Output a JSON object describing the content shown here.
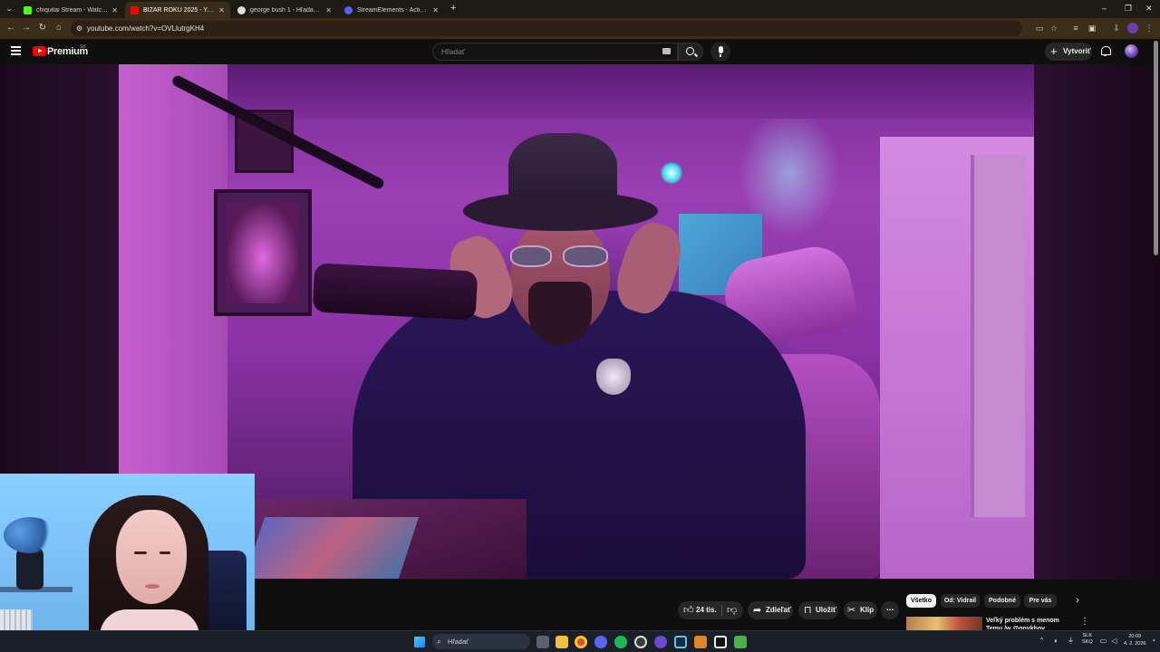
{
  "browser": {
    "tabs": [
      {
        "title": "chiquitai Stream - Watch Live o",
        "favicon_color": "#53fc18",
        "active": false
      },
      {
        "title": "BIZÁR ROKU 2025 - YouTube",
        "favicon_color": "#ff0000",
        "active": true
      },
      {
        "title": "george bush 1 - Hľadať Googli",
        "favicon_color": "#dddddd",
        "active": false
      },
      {
        "title": "StreamElements - Activity feed",
        "favicon_color": "#5b5bff",
        "active": false
      }
    ],
    "new_tab_label": "+",
    "url": "youtube.com/watch?v=OVLlutrgKH4",
    "window_controls": [
      "–",
      "❐",
      "✕"
    ]
  },
  "youtube": {
    "brand": "Premium",
    "country_code": "SK",
    "search_placeholder": "Hľadať",
    "create_label": "Vytvoriť",
    "actions": {
      "like_count": "24 tis.",
      "share_label": "Zdieľať",
      "save_label": "Uložiť",
      "clip_label": "Klip",
      "more_label": "⋯"
    },
    "chips": [
      "Všetko",
      "Od: Vidrail",
      "Podobné",
      "Pre vás"
    ],
    "recommendation": {
      "title": "Veľký problém s menom Temu /w @goykhov"
    },
    "colors": {
      "accent": "#ff0000",
      "background": "#0f0f0f",
      "chip_selected": "#f1f1f1"
    }
  },
  "taskbar": {
    "search_placeholder": "Hľadať",
    "language_line1": "SLK",
    "language_line2": "SKQ",
    "time": "20:09",
    "date": "4. 2. 2026",
    "apps": [
      {
        "name": "file-explorer-icon",
        "color": "#f0c040"
      },
      {
        "name": "chrome-icon",
        "color": "#e04a3a"
      },
      {
        "name": "discord-icon",
        "color": "#5865f2"
      },
      {
        "name": "spotify-icon",
        "color": "#1db954"
      },
      {
        "name": "obs-icon",
        "color": "#3a3a3a"
      },
      {
        "name": "app-purple-icon",
        "color": "#6a4ad0"
      },
      {
        "name": "steam-icon",
        "color": "#1b2838"
      },
      {
        "name": "app-orange-icon",
        "color": "#e0862a"
      },
      {
        "name": "app-black-icon",
        "color": "#111111"
      },
      {
        "name": "app-green-icon",
        "color": "#4caf50"
      }
    ]
  }
}
